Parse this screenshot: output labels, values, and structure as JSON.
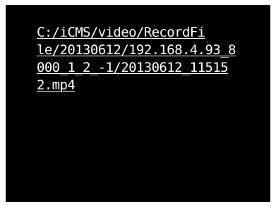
{
  "viewport": {
    "background_color": "#000000",
    "file_link": {
      "lines": [
        "C:/iCMS/video/RecordFi",
        "le/20130612/192.168.4.93_8",
        "000_1_2_-1/20130612_11515",
        "2.mp4"
      ],
      "text_color": "#ffffff"
    }
  }
}
